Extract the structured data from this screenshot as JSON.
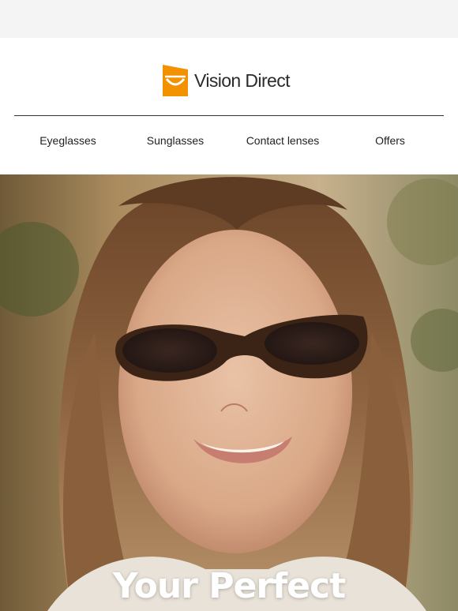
{
  "brand": {
    "name": "Vision Direct",
    "accent_color": "#f39200"
  },
  "nav": {
    "items": [
      {
        "label": "Eyeglasses"
      },
      {
        "label": "Sunglasses"
      },
      {
        "label": "Contact lenses"
      },
      {
        "label": "Offers"
      }
    ]
  },
  "hero": {
    "headline": "Your Perfect"
  }
}
